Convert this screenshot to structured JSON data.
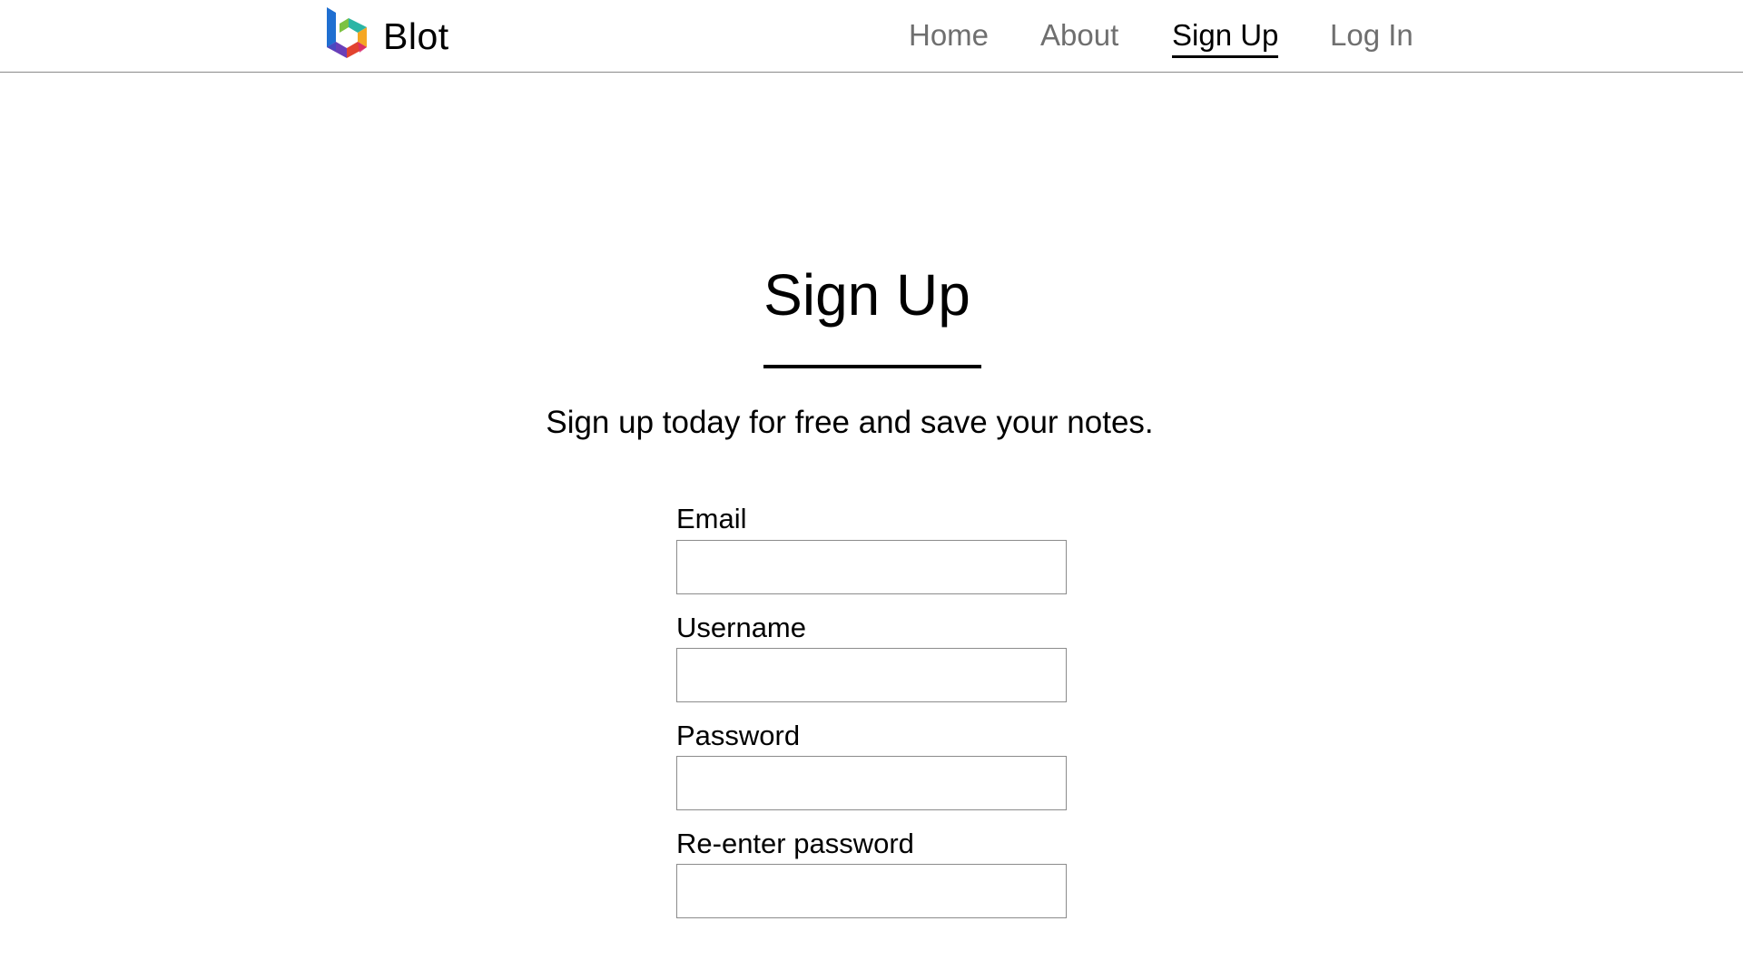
{
  "brand": {
    "name": "Blot",
    "icon": "blot-logo-icon"
  },
  "nav": {
    "items": [
      {
        "label": "Home",
        "active": false
      },
      {
        "label": "About",
        "active": false
      },
      {
        "label": "Sign Up",
        "active": true
      },
      {
        "label": "Log In",
        "active": false
      }
    ]
  },
  "page": {
    "title": "Sign Up",
    "subtitle": "Sign up today for free and save your notes."
  },
  "form": {
    "fields": [
      {
        "label": "Email",
        "value": "",
        "placeholder": ""
      },
      {
        "label": "Username",
        "value": "",
        "placeholder": ""
      },
      {
        "label": "Password",
        "value": "",
        "placeholder": ""
      },
      {
        "label": "Re-enter password",
        "value": "",
        "placeholder": ""
      }
    ]
  },
  "colors": {
    "nav_inactive": "#6f6f6f",
    "nav_active": "#000000",
    "input_border": "#8c8c8c",
    "header_border": "#8a8a8a"
  }
}
